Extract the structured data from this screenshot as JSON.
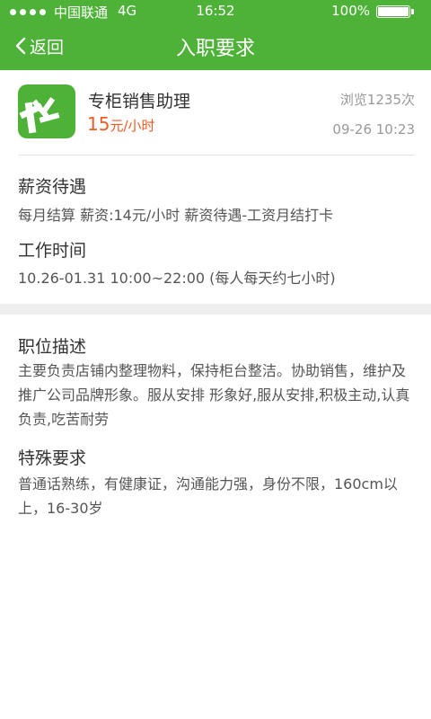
{
  "status_bar": {
    "carrier": "中国联通",
    "network": "4G",
    "time": "16:52",
    "battery": "100%"
  },
  "nav": {
    "back_label": "返回",
    "title": "入职要求"
  },
  "job": {
    "title": "专柜销售助理",
    "salary_amount": "15",
    "salary_unit": "元/小时",
    "views": "浏览1235次",
    "date": "09-26 10:23"
  },
  "pay": {
    "heading": "薪资待遇",
    "text": "每月结算 薪资:14元/小时   薪资待遇-工资月结打卡"
  },
  "hours": {
    "heading": "工作时间",
    "text": "10.26-01.31  10:00~22:00 (每人每天约七小时)"
  },
  "description": {
    "heading": "职位描述",
    "text": "主要负责店铺内整理物料，保持柜台整洁。协助销售，维护及推广公司品牌形象。服从安排 形象好,服从安排,积极主动,认真负责,吃苦耐劳"
  },
  "requirements": {
    "heading": "特殊要求",
    "text": "普通话熟练，有健康证，沟通能力强，身份不限，160cm以上，16-30岁"
  },
  "colors": {
    "brand_green": "#4fb238",
    "salary_orange": "#f05a24"
  }
}
